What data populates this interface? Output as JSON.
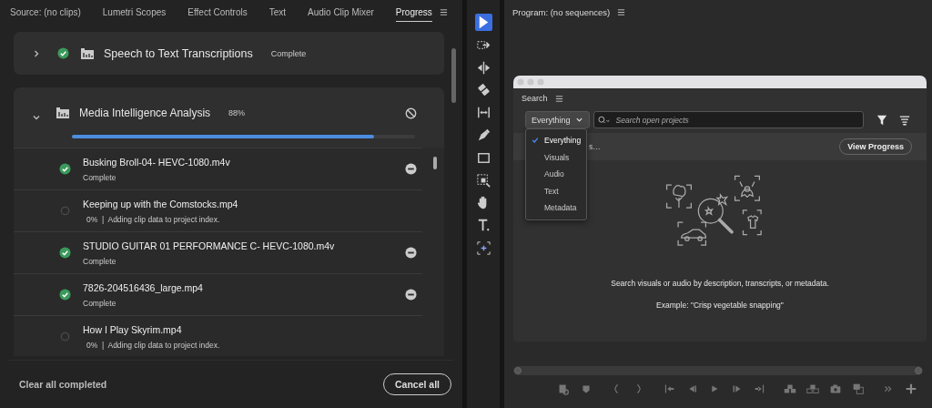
{
  "source_panel": {
    "tabs": [
      {
        "label": "Source: (no clips)",
        "selected": false,
        "menu": false
      },
      {
        "label": "Lumetri Scopes",
        "selected": false,
        "menu": false
      },
      {
        "label": "Effect Controls",
        "selected": false,
        "menu": false
      },
      {
        "label": "Text",
        "selected": false,
        "menu": false
      },
      {
        "label": "Audio Clip Mixer",
        "selected": false,
        "menu": false
      },
      {
        "label": "Progress",
        "selected": true,
        "menu": true
      }
    ],
    "tasks": [
      {
        "title": "Speech to Text Transcriptions",
        "status": "Complete",
        "done": true,
        "expanded": false
      },
      {
        "title": "Media Intelligence Analysis",
        "status": "88%",
        "done": false,
        "expanded": true,
        "level": 0.88,
        "items": [
          {
            "name": "Busking Broll-04- HEVC-1080.m4v",
            "status": "Complete",
            "done": true
          },
          {
            "name": "Keeping up with the Comstocks.mp4",
            "status": "0%  |  Adding clip data to project index.",
            "done": false
          },
          {
            "name": "STUDIO GUITAR 01 PERFORMANCE C- HEVC-1080.m4v",
            "status": "Complete",
            "done": true
          },
          {
            "name": "7826-204516436_large.mp4",
            "status": "Complete",
            "done": true
          },
          {
            "name": "How I Play Skyrim.mp4",
            "status": "0%  |  Adding clip data to project index.",
            "done": false
          }
        ]
      }
    ],
    "footer": {
      "clear_label": "Clear all completed",
      "cancel_label": "Cancel all"
    }
  },
  "tools": [
    {
      "kind": "select",
      "selected": true
    },
    {
      "kind": "track-select",
      "selected": false
    },
    {
      "kind": "ripple",
      "selected": false
    },
    {
      "kind": "razor",
      "selected": false
    },
    {
      "kind": "slip",
      "selected": false
    },
    {
      "kind": "pen",
      "selected": false
    },
    {
      "kind": "rectangle",
      "selected": false
    },
    {
      "kind": "zoom",
      "selected": false
    },
    {
      "kind": "hand",
      "selected": false
    },
    {
      "kind": "type",
      "selected": false
    },
    {
      "kind": "frame",
      "selected": false
    }
  ],
  "program_panel": {
    "title": "Program: (no sequences)"
  },
  "search_window": {
    "title": "Search",
    "scope": "Everything",
    "placeholder": "Search open projects",
    "scope_options": [
      {
        "label": "Everything",
        "selected": true
      },
      {
        "label": "Visuals",
        "selected": false
      },
      {
        "label": "Audio",
        "selected": false
      },
      {
        "label": "Text",
        "selected": false
      },
      {
        "label": "Metadata",
        "selected": false
      }
    ],
    "banner_text": "s…",
    "banner_button": "View Progress",
    "hint": "Search visuals or audio by description, transcripts, or metadata.",
    "example": "Example: \"Crisp vegetable snapping\""
  }
}
